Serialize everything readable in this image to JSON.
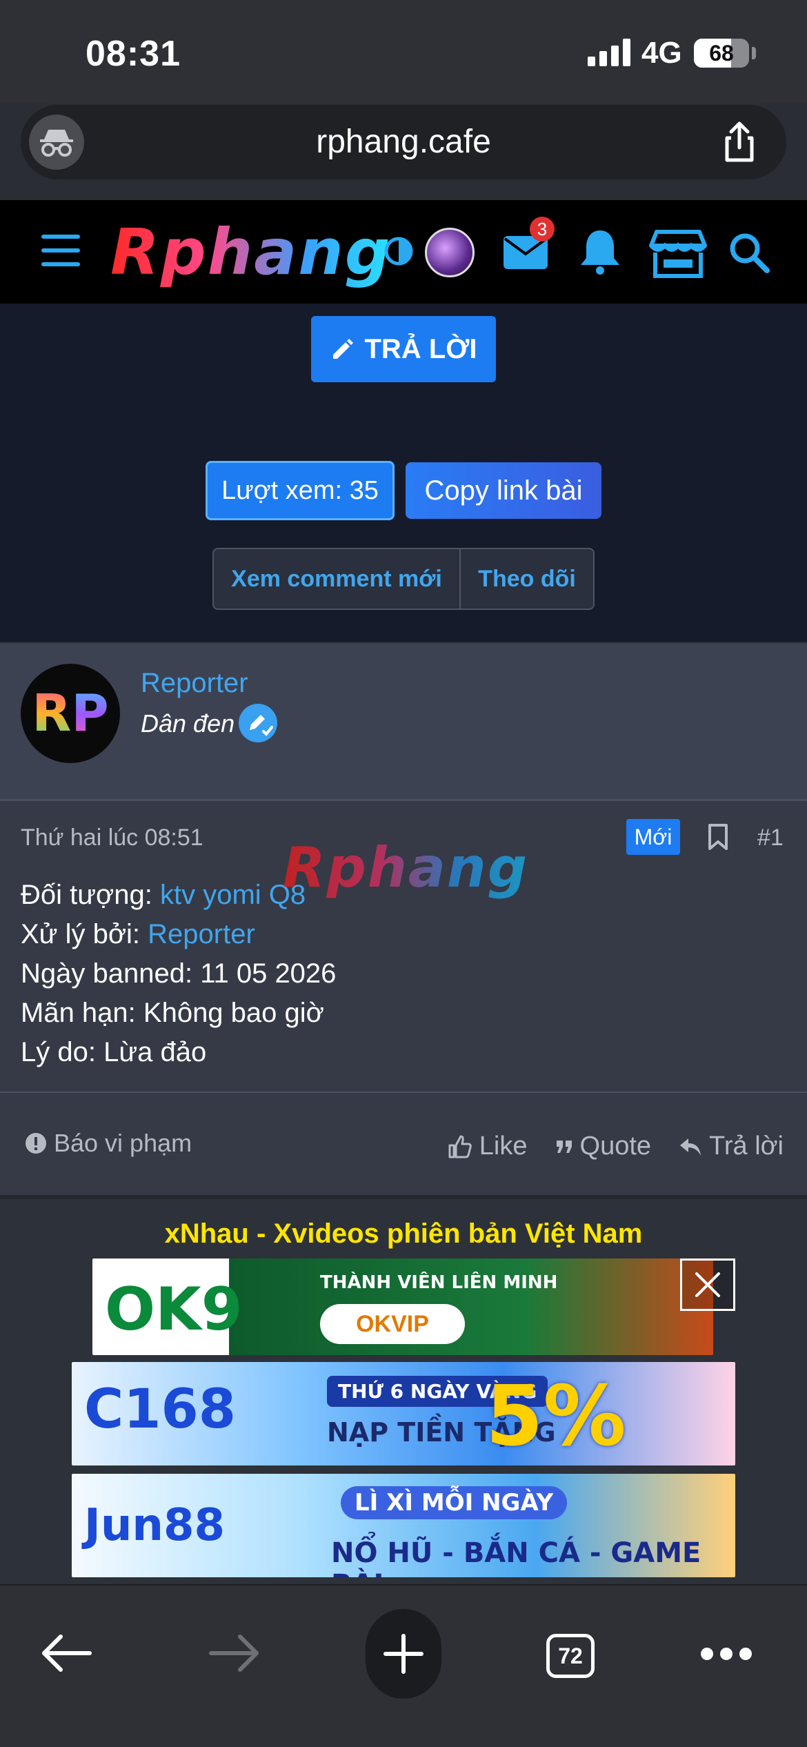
{
  "status_bar": {
    "time": "08:31",
    "network": "4G",
    "battery": "68",
    "battery_level": 0.68
  },
  "browser": {
    "url": "rphang.cafe"
  },
  "site_header": {
    "logo": "Rphang",
    "mail_badge": "3"
  },
  "thread_actions": {
    "reply_label": "TRẢ LỜI",
    "views_label": "Lượt xem: 35",
    "copy_link_label": "Copy link bài",
    "new_comments_label": "Xem comment mới",
    "follow_label": "Theo dõi"
  },
  "post": {
    "user": {
      "avatar_text_r": "R",
      "avatar_text_p": "P",
      "name": "Reporter",
      "title": "Dân đen"
    },
    "date": "Thứ hai lúc 08:51",
    "new_badge": "Mới",
    "number": "#1",
    "watermark": "Rphang",
    "lines": {
      "target_label": "Đối tượng: ",
      "target_value": "ktv yomi Q8",
      "handled_label": "Xử lý bởi: ",
      "handled_value": "Reporter",
      "banned_date": "Ngày banned: 11 05 2026",
      "expiry": "Mãn hạn: Không bao giờ",
      "reason": "Lý do: Lừa đảo"
    },
    "footer": {
      "report_label": "Báo vi phạm",
      "like_label": "Like",
      "quote_label": "Quote",
      "reply_label": "Trả lời"
    }
  },
  "ads": {
    "title": "xNhau - Xvideos phiên bản Việt Nam",
    "banners": [
      {
        "brand": "OK9",
        "sub": "THÀNH VIÊN LIÊN MINH",
        "pill": "OKVIP"
      },
      {
        "brand": "C168",
        "sub": "THỨ 6 NGÀY VÀNG",
        "sub2": "NẠP TIỀN TẶNG",
        "big": "5%"
      },
      {
        "brand": "Jun88",
        "sub": "LÌ XÌ MỖI NGÀY",
        "sub2": "NỔ HŨ - BẮN CÁ - GAME BÀI"
      }
    ]
  },
  "toolbar": {
    "tab_count": "72"
  },
  "colors": {
    "accent_blue": "#1d7cf2",
    "link_blue": "#41a6ee",
    "ad_title": "#ffe600",
    "badge_red": "#e03131"
  }
}
